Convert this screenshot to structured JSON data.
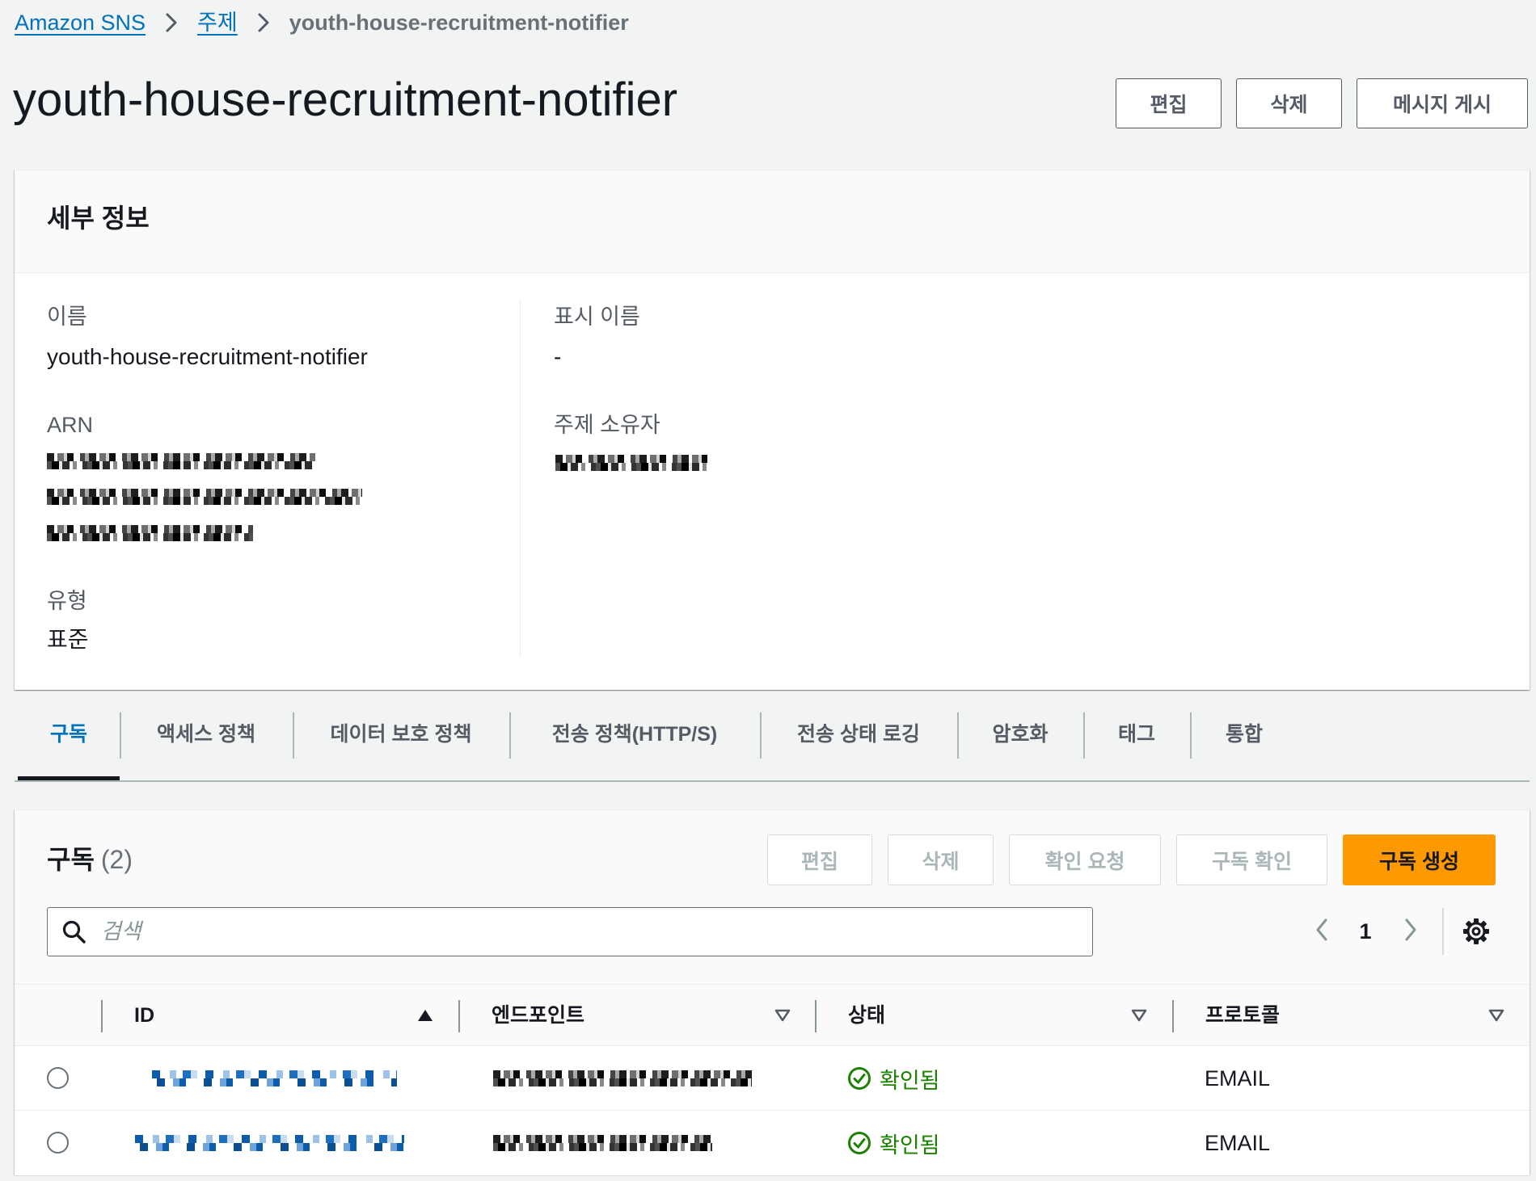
{
  "breadcrumb": {
    "items": [
      {
        "label": "Amazon SNS"
      },
      {
        "label": "주제"
      },
      {
        "label": "youth-house-recruitment-notifier"
      }
    ]
  },
  "header": {
    "title": "youth-house-recruitment-notifier",
    "actions": {
      "edit": "편집",
      "delete": "삭제",
      "publish": "메시지 게시"
    }
  },
  "details": {
    "title": "세부 정보",
    "name": {
      "label": "이름",
      "value": "youth-house-recruitment-notifier"
    },
    "arn": {
      "label": "ARN"
    },
    "type": {
      "label": "유형",
      "value": "표준"
    },
    "display_name": {
      "label": "표시 이름",
      "value": "-"
    },
    "owner": {
      "label": "주제 소유자"
    }
  },
  "tabs": [
    {
      "label": "구독",
      "active": true
    },
    {
      "label": "액세스 정책",
      "active": false
    },
    {
      "label": "데이터 보호 정책",
      "active": false
    },
    {
      "label": "전송 정책(HTTP/S)",
      "active": false
    },
    {
      "label": "전송 상태 로깅",
      "active": false
    },
    {
      "label": "암호화",
      "active": false
    },
    {
      "label": "태그",
      "active": false
    },
    {
      "label": "통합",
      "active": false
    }
  ],
  "subscriptions": {
    "title": "구독",
    "count": "(2)",
    "actions": {
      "edit": {
        "label": "편집",
        "enabled": false
      },
      "delete": {
        "label": "삭제",
        "enabled": false
      },
      "request_confirmation": {
        "label": "확인 요청",
        "enabled": false
      },
      "confirm": {
        "label": "구독 확인",
        "enabled": false
      },
      "create": {
        "label": "구독 생성",
        "enabled": true
      }
    },
    "search": {
      "placeholder": "검색"
    },
    "pagination": {
      "current_page": "1"
    },
    "columns": [
      {
        "label": "ID",
        "sort": "ascending"
      },
      {
        "label": "엔드포인트",
        "sort": "none"
      },
      {
        "label": "상태",
        "sort": "none"
      },
      {
        "label": "프로토콜",
        "sort": "none"
      }
    ],
    "rows": [
      {
        "selected": false,
        "status": "확인됨",
        "protocol": "EMAIL"
      },
      {
        "selected": false,
        "status": "확인됨",
        "protocol": "EMAIL"
      }
    ]
  },
  "icons": {
    "breadcrumb_separator": "chevron-right-icon",
    "search": "search-icon",
    "pagination_prev": "chevron-left-icon",
    "pagination_next": "chevron-right-icon",
    "preferences": "gear-icon",
    "status_confirmed": "check-circle-icon",
    "sort_ascending": "caret-up-filled-icon",
    "sort_none": "caret-down-outline-icon"
  },
  "colors": {
    "link": "#0073bb",
    "text": "#16191f",
    "secondary_text": "#545b64",
    "success": "#1d8102",
    "primary_action": "#ff9900",
    "page_background": "#f2f3f3",
    "panel_header": "#fafafa"
  }
}
